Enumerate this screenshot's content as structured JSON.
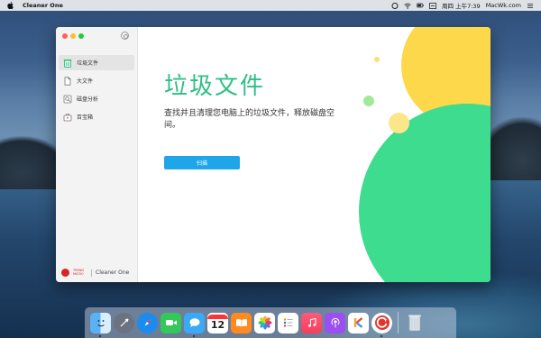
{
  "menubar": {
    "app_name": "Cleaner One",
    "datetime": "周四 上午7:39",
    "watermark": "MacWk.com"
  },
  "sidebar": {
    "items": [
      {
        "label": "垃圾文件",
        "icon": "trash-icon",
        "active": true
      },
      {
        "label": "大文件",
        "icon": "file-icon",
        "active": false
      },
      {
        "label": "磁盘分析",
        "icon": "disk-analysis-icon",
        "active": false
      },
      {
        "label": "百宝箱",
        "icon": "toolbox-icon",
        "active": false
      }
    ],
    "footer_brand": "TREND MICRO",
    "footer_product": "Cleaner One"
  },
  "main": {
    "title": "垃圾文件",
    "description": "查找并且清理您电脑上的垃圾文件，释放磁盘空间。",
    "scan_button": "扫描"
  },
  "dock": {
    "calendar_date": "12",
    "apps": [
      "finder-icon",
      "launchpad-icon",
      "safari-icon",
      "facetime-icon",
      "messages-icon",
      "calendar-icon",
      "books-icon",
      "photos-icon",
      "reminders-icon",
      "music-icon",
      "podcasts-icon",
      "klokki-icon",
      "cleaner-one-icon",
      "trash-icon"
    ]
  },
  "colors": {
    "accent_green": "#2ebf85",
    "button_blue": "#1ea6e8",
    "deco_yellow": "#fcd84a",
    "deco_green": "#3ddc8f"
  }
}
